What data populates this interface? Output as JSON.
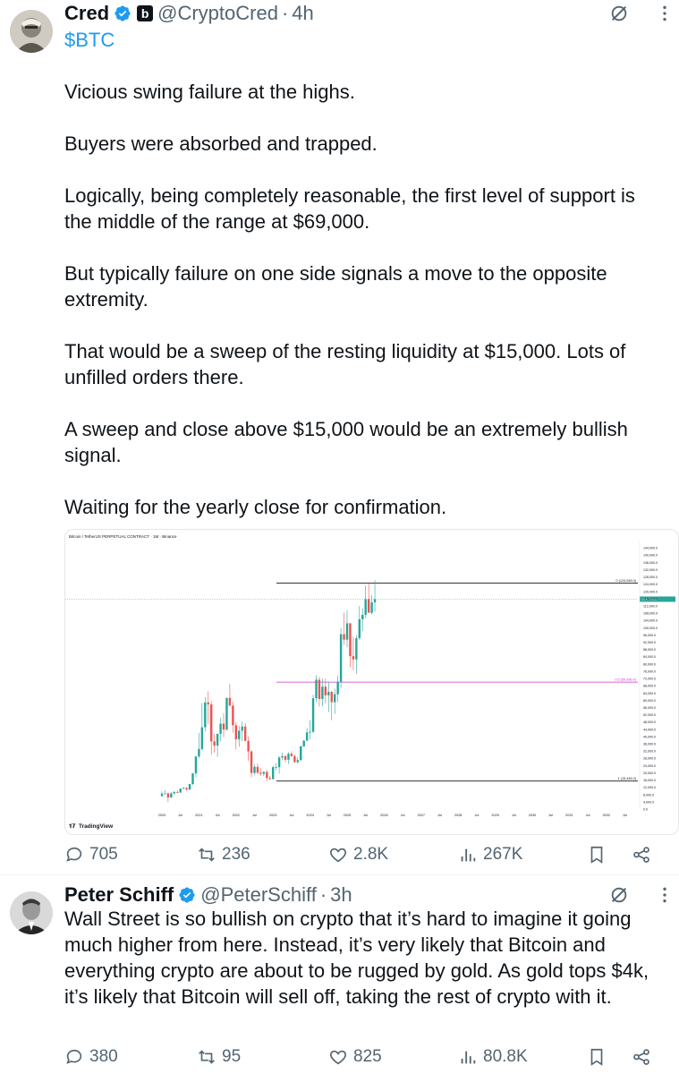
{
  "tweets": [
    {
      "name": "Cred",
      "handle": "@CryptoCred",
      "affiliate_badge": "b",
      "time": "4h",
      "cashtag": "$BTC",
      "paragraphs": [
        "Vicious swing failure at the highs.",
        "Buyers were absorbed and trapped.",
        "Logically, being completely reasonable, the first level of support is the middle of the range at $69,000.",
        "But typically failure on one side signals a move to the opposite extremity.",
        "That would be a sweep of the resting liquidity at $15,000. Lots of unfilled orders there.",
        "A sweep and close above $15,000 would be an extremely bullish signal.",
        "Waiting for the yearly close for confirmation."
      ],
      "stats": {
        "replies": "705",
        "reposts": "236",
        "likes": "2.8K",
        "views": "267K"
      }
    },
    {
      "name": "Peter Schiff",
      "handle": "@PeterSchiff",
      "time": "3h",
      "text": "Wall Street is so bullish on crypto that it’s hard to imagine it going much higher from here. Instead, it’s very likely that Bitcoin and everything crypto are about to be rugged by gold. As gold tops $4k, it’s likely that Bitcoin will sell off, taking the rest of crypto with it.",
      "stats": {
        "replies": "380",
        "reposts": "95",
        "likes": "825",
        "views": "80.8K"
      }
    }
  ],
  "chart_data": {
    "type": "candlestick",
    "title": "Bitcoin / TetherUS PERPETUAL CONTRACT · 1M · Binance",
    "watermark": "TradingView",
    "x_ticks": [
      "2020",
      "Jul",
      "2021",
      "Jul",
      "2022",
      "Jul",
      "2023",
      "Jul",
      "2024",
      "Jul",
      "2025",
      "Jul",
      "2026",
      "Jul",
      "2027",
      "Jul",
      "2028",
      "Jul",
      "2029",
      "Jul",
      "2030",
      "Jul",
      "2031",
      "Jul",
      "2032",
      "Jul"
    ],
    "y_ticks": [
      "144,000.0",
      "140,000.0",
      "136,000.0",
      "132,000.0",
      "128,000.0",
      "124,000.0",
      "120,000.0",
      "116,000.0",
      "112,000.0",
      "108,000.0",
      "104,000.0",
      "100,000.0",
      "96,000.0",
      "92,000.0",
      "88,000.0",
      "84,000.0",
      "80,000.0",
      "76,000.0",
      "72,000.0",
      "68,000.0",
      "64,000.0",
      "60,000.0",
      "56,000.0",
      "52,000.0",
      "48,000.0",
      "44,000.0",
      "40,000.0",
      "36,000.0",
      "32,000.0",
      "28,000.0",
      "24,000.0",
      "20,000.0",
      "16,000.0",
      "12,000.0",
      "8,000.0",
      "4,000.0",
      "0.0"
    ],
    "levels": [
      {
        "label": "0 (124,546.0)",
        "value": 124546,
        "color": "#131722"
      },
      {
        "label": "0.5 (69,996.0)",
        "value": 69996,
        "color": "#cc33cc"
      },
      {
        "label": "1 (15,446.0)",
        "value": 15446,
        "color": "#131722"
      }
    ],
    "last_price_label": "115,706.2",
    "ylim": [
      0,
      148000
    ],
    "candles": [
      {
        "o": 7200,
        "h": 9600,
        "l": 6900,
        "c": 8500
      },
      {
        "o": 8500,
        "h": 10500,
        "l": 8400,
        "c": 8600
      },
      {
        "o": 8600,
        "h": 9200,
        "l": 3800,
        "c": 6400
      },
      {
        "o": 6400,
        "h": 9500,
        "l": 6200,
        "c": 8600
      },
      {
        "o": 8600,
        "h": 10000,
        "l": 8100,
        "c": 9400
      },
      {
        "o": 9400,
        "h": 10400,
        "l": 8900,
        "c": 9100
      },
      {
        "o": 9100,
        "h": 11400,
        "l": 9000,
        "c": 11300
      },
      {
        "o": 11300,
        "h": 12400,
        "l": 11000,
        "c": 11600
      },
      {
        "o": 11600,
        "h": 12000,
        "l": 10000,
        "c": 10800
      },
      {
        "o": 10800,
        "h": 14000,
        "l": 10400,
        "c": 13800
      },
      {
        "o": 13800,
        "h": 19800,
        "l": 13200,
        "c": 19700
      },
      {
        "o": 19700,
        "h": 29300,
        "l": 17600,
        "c": 29000
      },
      {
        "o": 29000,
        "h": 42000,
        "l": 28000,
        "c": 33100
      },
      {
        "o": 33100,
        "h": 58400,
        "l": 32300,
        "c": 45100
      },
      {
        "o": 45100,
        "h": 61800,
        "l": 43000,
        "c": 58800
      },
      {
        "o": 58800,
        "h": 64900,
        "l": 47000,
        "c": 57700
      },
      {
        "o": 57700,
        "h": 59500,
        "l": 30000,
        "c": 37300
      },
      {
        "o": 37300,
        "h": 41300,
        "l": 31100,
        "c": 35000
      },
      {
        "o": 35000,
        "h": 36700,
        "l": 28800,
        "c": 41500
      },
      {
        "o": 41500,
        "h": 50500,
        "l": 37300,
        "c": 47100
      },
      {
        "o": 47100,
        "h": 52900,
        "l": 39600,
        "c": 43800
      },
      {
        "o": 43800,
        "h": 61000,
        "l": 43200,
        "c": 61300
      },
      {
        "o": 61300,
        "h": 69000,
        "l": 57000,
        "c": 57000
      },
      {
        "o": 57000,
        "h": 59200,
        "l": 42000,
        "c": 46200
      },
      {
        "o": 46200,
        "h": 48000,
        "l": 32900,
        "c": 38500
      },
      {
        "o": 38500,
        "h": 45800,
        "l": 34300,
        "c": 43200
      },
      {
        "o": 43200,
        "h": 48200,
        "l": 37600,
        "c": 45500
      },
      {
        "o": 45500,
        "h": 47400,
        "l": 37700,
        "c": 37600
      },
      {
        "o": 37600,
        "h": 40000,
        "l": 26700,
        "c": 31800
      },
      {
        "o": 31800,
        "h": 32400,
        "l": 17600,
        "c": 19900
      },
      {
        "o": 19900,
        "h": 24600,
        "l": 18800,
        "c": 23300
      },
      {
        "o": 23300,
        "h": 25200,
        "l": 19500,
        "c": 20000
      },
      {
        "o": 20000,
        "h": 22800,
        "l": 18200,
        "c": 19400
      },
      {
        "o": 19400,
        "h": 20900,
        "l": 18100,
        "c": 20500
      },
      {
        "o": 20500,
        "h": 21500,
        "l": 15500,
        "c": 17100
      },
      {
        "o": 17100,
        "h": 18300,
        "l": 16200,
        "c": 16500
      },
      {
        "o": 16500,
        "h": 23900,
        "l": 16400,
        "c": 23100
      },
      {
        "o": 23100,
        "h": 25200,
        "l": 21300,
        "c": 23100
      },
      {
        "o": 23100,
        "h": 29200,
        "l": 19500,
        "c": 28400
      },
      {
        "o": 28400,
        "h": 31000,
        "l": 26900,
        "c": 29200
      },
      {
        "o": 29200,
        "h": 29800,
        "l": 25800,
        "c": 27200
      },
      {
        "o": 27200,
        "h": 31400,
        "l": 24800,
        "c": 30500
      },
      {
        "o": 30500,
        "h": 31800,
        "l": 28800,
        "c": 29200
      },
      {
        "o": 29200,
        "h": 30100,
        "l": 25400,
        "c": 25900
      },
      {
        "o": 25900,
        "h": 28600,
        "l": 24900,
        "c": 27000
      },
      {
        "o": 27000,
        "h": 35000,
        "l": 26500,
        "c": 34600
      },
      {
        "o": 34600,
        "h": 38000,
        "l": 34100,
        "c": 37700
      },
      {
        "o": 37700,
        "h": 44700,
        "l": 37600,
        "c": 42300
      },
      {
        "o": 42300,
        "h": 48900,
        "l": 38500,
        "c": 42600
      },
      {
        "o": 42600,
        "h": 63000,
        "l": 41900,
        "c": 61100
      },
      {
        "o": 61100,
        "h": 73800,
        "l": 59000,
        "c": 71300
      },
      {
        "o": 71300,
        "h": 72800,
        "l": 56500,
        "c": 60700
      },
      {
        "o": 60700,
        "h": 71900,
        "l": 56600,
        "c": 67500
      },
      {
        "o": 67500,
        "h": 71900,
        "l": 58400,
        "c": 62700
      },
      {
        "o": 62700,
        "h": 70000,
        "l": 53500,
        "c": 64600
      },
      {
        "o": 64600,
        "h": 65100,
        "l": 49000,
        "c": 58900
      },
      {
        "o": 58900,
        "h": 66500,
        "l": 52500,
        "c": 63300
      },
      {
        "o": 63300,
        "h": 73600,
        "l": 58900,
        "c": 70200
      },
      {
        "o": 70200,
        "h": 99800,
        "l": 66800,
        "c": 96400
      },
      {
        "o": 96400,
        "h": 108300,
        "l": 90500,
        "c": 93400
      },
      {
        "o": 93400,
        "h": 109500,
        "l": 89200,
        "c": 102400
      },
      {
        "o": 102400,
        "h": 102500,
        "l": 78200,
        "c": 84300
      },
      {
        "o": 84300,
        "h": 95000,
        "l": 76600,
        "c": 82500
      },
      {
        "o": 82500,
        "h": 95800,
        "l": 74500,
        "c": 94200
      },
      {
        "o": 94200,
        "h": 111900,
        "l": 93300,
        "c": 104600
      },
      {
        "o": 104600,
        "h": 110500,
        "l": 98200,
        "c": 107100
      },
      {
        "o": 107100,
        "h": 123200,
        "l": 105200,
        "c": 115700
      },
      {
        "o": 115700,
        "h": 124500,
        "l": 112000,
        "c": 108200
      },
      {
        "o": 108200,
        "h": 117900,
        "l": 107300,
        "c": 114000
      },
      {
        "o": 114000,
        "h": 126200,
        "l": 108800,
        "c": 115706
      }
    ]
  }
}
